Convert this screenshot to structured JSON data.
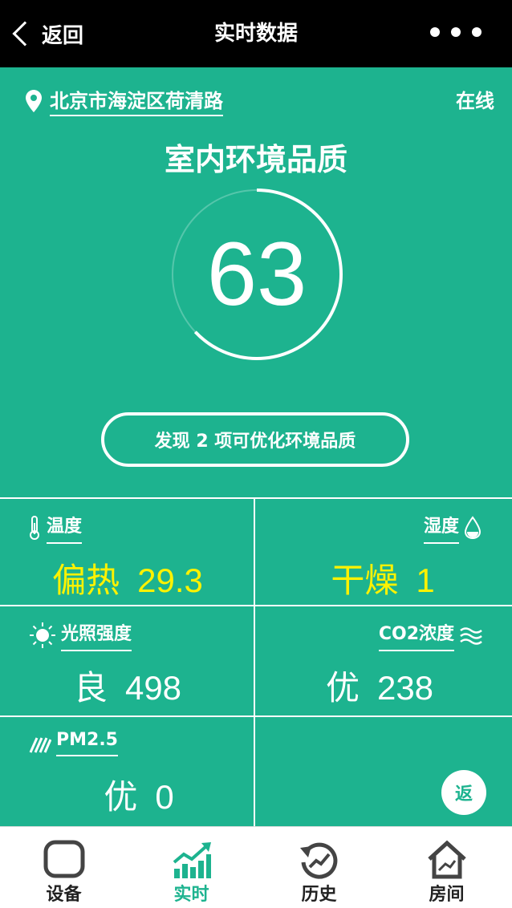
{
  "header": {
    "back_label": "返回",
    "title": "实时数据"
  },
  "hero": {
    "location": "北京市海淀区荷清路",
    "status": "在线",
    "title": "室内环境品质",
    "score": "63",
    "score_fraction": 0.63,
    "optimize_button": "发现 2 项可优化环境品质"
  },
  "metrics": [
    {
      "name": "温度",
      "level": "偏热",
      "value": "29.3",
      "icon": "thermometer-icon"
    },
    {
      "name": "湿度",
      "level": "干燥",
      "value": "1",
      "icon": "water-drop-icon"
    },
    {
      "name": "光照强度",
      "level": "良",
      "value": "498",
      "icon": "sun-icon"
    },
    {
      "name": "CO2浓度",
      "level": "优",
      "value": "238",
      "icon": "wave-icon"
    },
    {
      "name": "PM2.5",
      "level": "优",
      "value": "0",
      "icon": "particles-icon"
    }
  ],
  "fab_label": "返",
  "tabs": [
    {
      "label": "设备",
      "icon": "device-icon"
    },
    {
      "label": "实时",
      "icon": "chart-up-icon"
    },
    {
      "label": "历史",
      "icon": "history-icon"
    },
    {
      "label": "房间",
      "icon": "house-icon"
    }
  ],
  "colors": {
    "primary": "#1db38f",
    "warning": "#fff200",
    "header": "#000000"
  }
}
